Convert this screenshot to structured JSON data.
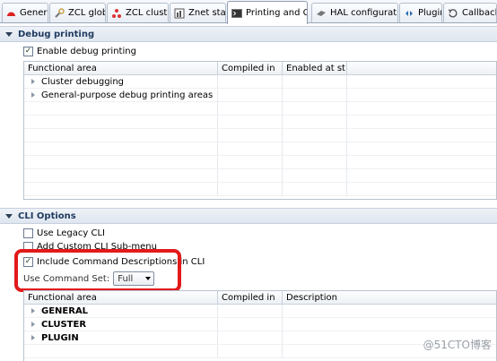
{
  "tabs": [
    {
      "label": "General",
      "icon": "general-icon"
    },
    {
      "label": "ZCL global",
      "icon": "wrench-icon"
    },
    {
      "label": "ZCL clusters",
      "icon": "clusters-icon"
    },
    {
      "label": "Znet stack",
      "icon": "stack-icon"
    },
    {
      "label": "Printing and CLI",
      "icon": "terminal-icon",
      "active": true
    },
    {
      "label": "HAL configuration",
      "icon": "chip-icon"
    },
    {
      "label": "Plugins",
      "icon": "plugin-icon"
    },
    {
      "label": "Callbacks",
      "icon": "callbacks-icon"
    }
  ],
  "debug": {
    "title": "Debug printing",
    "enable_label": "Enable debug printing",
    "enable_checked": true,
    "columns": [
      "Functional area",
      "Compiled in",
      "Enabled at st..."
    ],
    "rows": [
      {
        "area": "Cluster debugging",
        "compiled": "",
        "enabled": ""
      },
      {
        "area": "General-purpose debug printing areas",
        "compiled": "",
        "enabled": ""
      }
    ]
  },
  "cli": {
    "title": "CLI Options",
    "legacy_label": "Use Legacy CLI",
    "legacy_checked": false,
    "custom_label": "Add Custom CLI Sub-menu",
    "custom_checked": false,
    "include_label": "Include Command Descriptions in CLI",
    "include_checked": true,
    "command_set_label": "Use Command Set:",
    "command_set_value": "Full",
    "columns": [
      "Functional area",
      "Compiled in",
      "Description"
    ],
    "rows": [
      {
        "area": "GENERAL",
        "compiled": "",
        "description": ""
      },
      {
        "area": "CLUSTER",
        "compiled": "",
        "description": ""
      },
      {
        "area": "PLUGIN",
        "compiled": "",
        "description": ""
      }
    ]
  },
  "watermark": "@51CTO博客",
  "colors": {
    "highlight": "#e21a1a",
    "section_text": "#1f3a5f"
  }
}
